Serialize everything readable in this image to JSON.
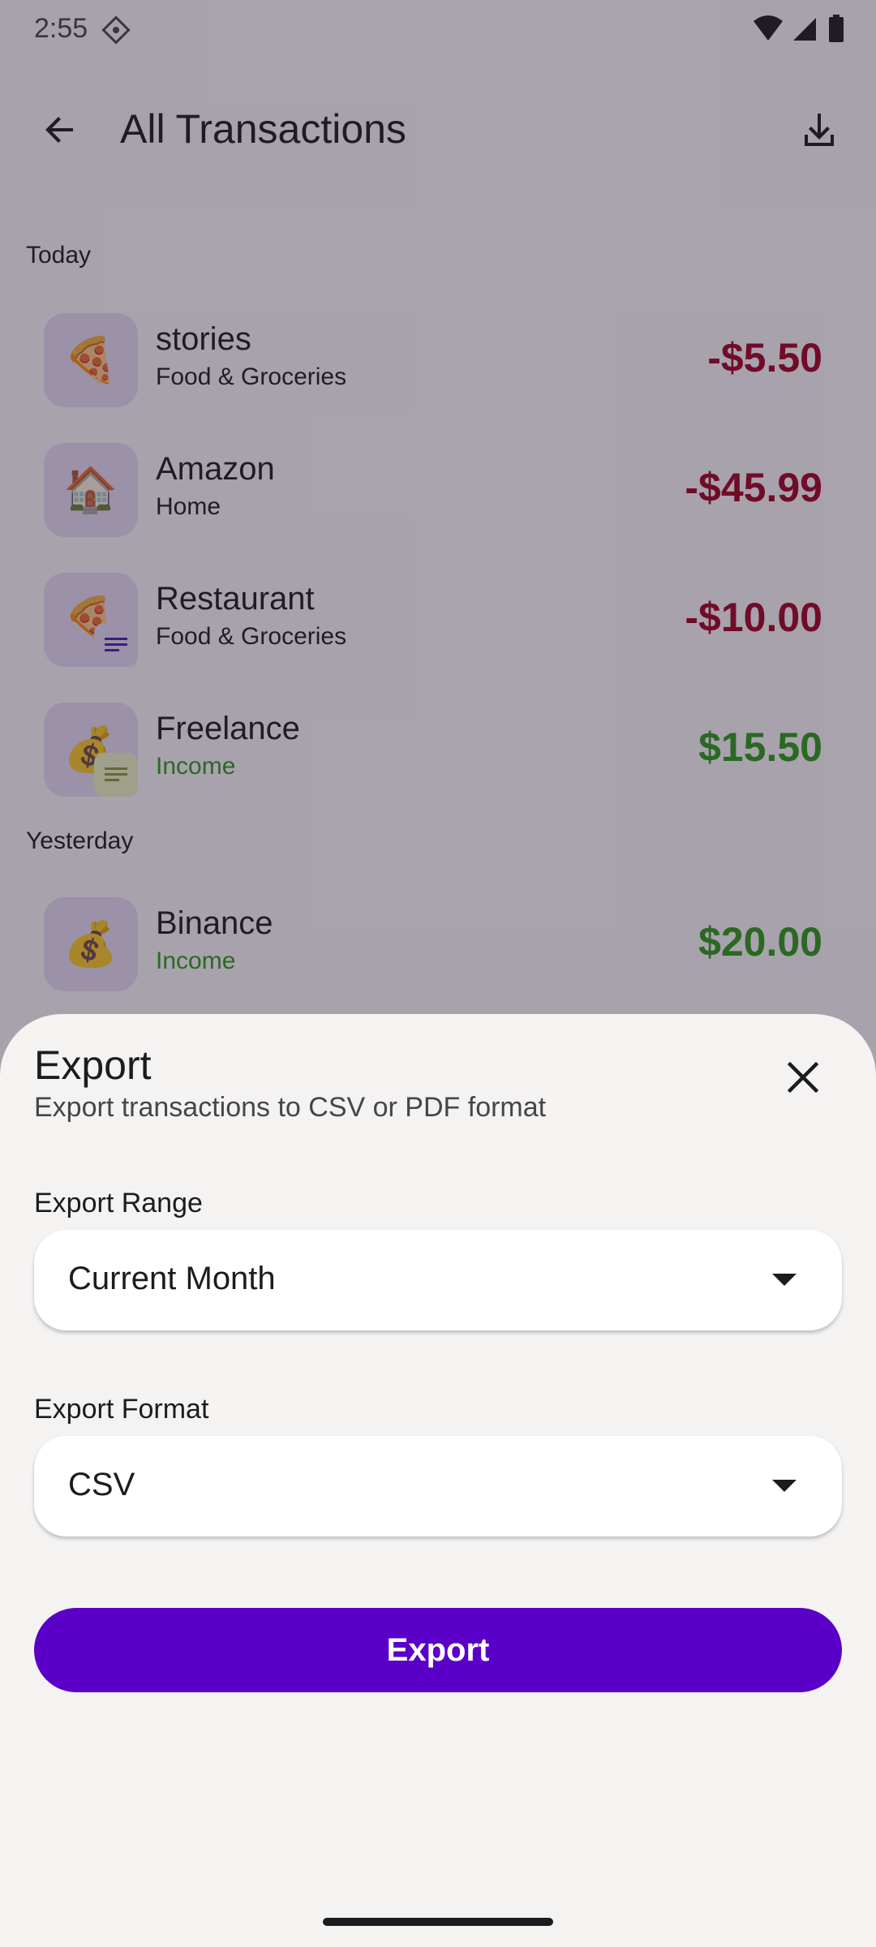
{
  "status_bar": {
    "time": "2:55"
  },
  "app_bar": {
    "title": "All Transactions",
    "back_icon": "arrow-back-icon",
    "download_icon": "download-icon"
  },
  "sections": [
    {
      "label": "Today",
      "transactions": [
        {
          "icon": "🍕",
          "icon_name": "pizza-icon",
          "title": "stories",
          "category": "Food & Groceries",
          "amount": "-$5.50",
          "type": "expense",
          "has_note": false
        },
        {
          "icon": "🏠",
          "icon_name": "house-icon",
          "title": "Amazon",
          "category": "Home",
          "amount": "-$45.99",
          "type": "expense",
          "has_note": false
        },
        {
          "icon": "🍕",
          "icon_name": "pizza-icon",
          "title": "Restaurant",
          "category": "Food & Groceries",
          "amount": "-$10.00",
          "type": "expense",
          "has_note": true
        },
        {
          "icon": "💰",
          "icon_name": "money-bag-icon",
          "title": "Freelance",
          "category": "Income",
          "amount": "$15.50",
          "type": "income",
          "has_note": true
        }
      ]
    },
    {
      "label": "Yesterday",
      "transactions": [
        {
          "icon": "💰",
          "icon_name": "money-bag-icon",
          "title": "Binance",
          "category": "Income",
          "amount": "$20.00",
          "type": "income",
          "has_note": false
        }
      ]
    }
  ],
  "export_sheet": {
    "title": "Export",
    "subtitle": "Export transactions to CSV or PDF format",
    "close_icon": "close-icon",
    "range_label": "Export Range",
    "range_value": "Current Month",
    "format_label": "Export Format",
    "format_value": "CSV",
    "button_label": "Export"
  },
  "colors": {
    "expense": "#a00022",
    "income": "#2e9a1a",
    "accent": "#5a00c8",
    "icon_bg": "#e8def8"
  }
}
